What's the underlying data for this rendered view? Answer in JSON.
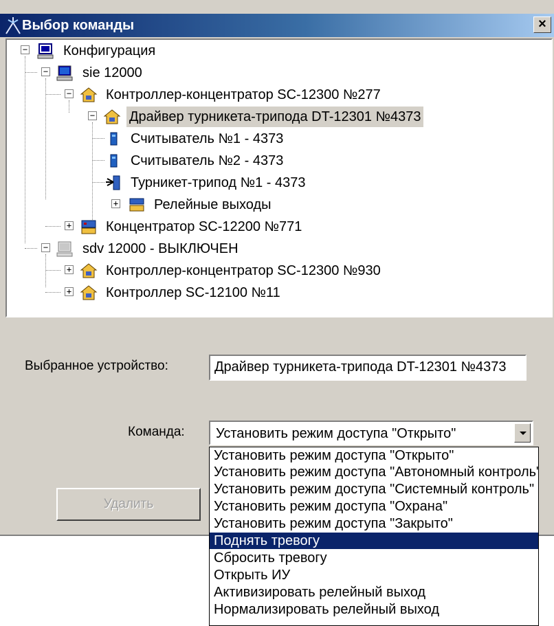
{
  "window": {
    "title": "Выбор команды",
    "close_label": "×",
    "face_color": "#d4d0c8",
    "title_color": "#0a246a"
  },
  "tree": {
    "items": [
      {
        "label": "Конфигурация",
        "icon": "computer-config-icon"
      },
      {
        "label": "sie 12000",
        "icon": "computer-icon"
      },
      {
        "label": "Контроллер-концентратор SC-12300 №277",
        "icon": "controller-icon"
      },
      {
        "label": "Драйвер турникета-трипода DT-12301 №4373",
        "icon": "controller-icon",
        "selected": true
      },
      {
        "label": "Считыватель №1 - 4373",
        "icon": "reader-icon"
      },
      {
        "label": "Считыватель №2 - 4373",
        "icon": "reader-icon"
      },
      {
        "label": "Турникет-трипод №1 - 4373",
        "icon": "turnstile-icon"
      },
      {
        "label": "Релейные выходы",
        "icon": "relay-outputs-icon"
      },
      {
        "label": "Концентратор SC-12200 №771",
        "icon": "concentrator-icon"
      },
      {
        "label": "sdv 12000 - ВЫКЛЮЧЕН",
        "icon": "computer-off-icon"
      },
      {
        "label": "Контроллер-концентратор SC-12300 №930",
        "icon": "controller-icon"
      },
      {
        "label": "Контроллер SC-12100 №11",
        "icon": "controller-icon"
      }
    ],
    "selection_color": "#d4d0c8"
  },
  "form": {
    "device_label": "Выбранное устройство:",
    "device_value": "Драйвер турникета-трипода DT-12301 №4373",
    "command_label": "Команда:",
    "command_value": "Установить режим доступа \"Открыто\""
  },
  "buttons": {
    "delete_label": "Удалить"
  },
  "dropdown": {
    "options": [
      "Установить режим доступа \"Открыто\"",
      "Установить режим доступа \"Автономный контроль\"",
      "Установить режим доступа \"Системный контроль\"",
      "Установить режим доступа \"Охрана\"",
      "Установить режим доступа \"Закрыто\"",
      "Поднять тревогу",
      "Сбросить тревогу",
      "Открыть ИУ",
      "Активизировать релейный выход",
      "Нормализировать релейный выход"
    ],
    "highlighted_index": 5,
    "highlight_color": "#0a246a"
  }
}
